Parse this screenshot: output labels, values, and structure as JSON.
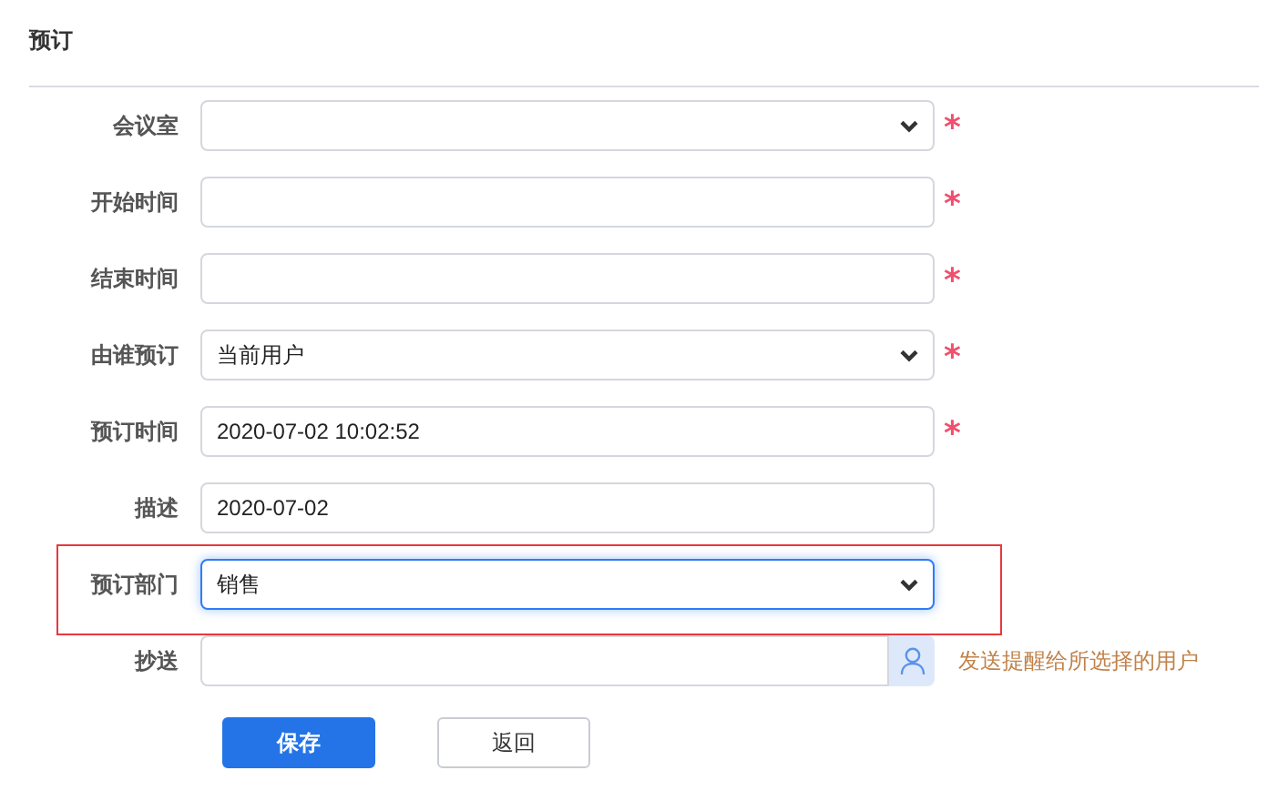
{
  "title": "预订",
  "fields": [
    {
      "label": "会议室",
      "kind": "select",
      "required": true,
      "required_mark": "*",
      "focused": false,
      "highlighted": false
    },
    {
      "label": "开始时间",
      "kind": "input",
      "required": true,
      "required_mark": "*",
      "focused": false,
      "highlighted": false
    },
    {
      "label": "结束时间",
      "kind": "input",
      "required": true,
      "required_mark": "*",
      "focused": false,
      "highlighted": false
    },
    {
      "label": "由谁预订",
      "kind": "select",
      "value": "当前用户",
      "required": true,
      "required_mark": "*",
      "focused": false,
      "highlighted": false
    },
    {
      "label": "预订时间",
      "kind": "input",
      "value": "2020-07-02 10:02:52",
      "required": true,
      "required_mark": "*",
      "focused": false,
      "highlighted": false
    },
    {
      "label": "描述",
      "kind": "input",
      "value": "2020-07-02",
      "required": false,
      "focused": false,
      "highlighted": false
    },
    {
      "label": "预订部门",
      "kind": "select",
      "value": "销售",
      "required": false,
      "focused": true,
      "highlighted": true
    },
    {
      "label": "抄送",
      "kind": "user_picker",
      "required": false,
      "focused": false,
      "highlighted": false,
      "hint": "发送提醒给所选择的用户"
    }
  ],
  "buttons": [
    {
      "label": "保存",
      "primary": true
    },
    {
      "label": "返回",
      "primary": false
    }
  ]
}
